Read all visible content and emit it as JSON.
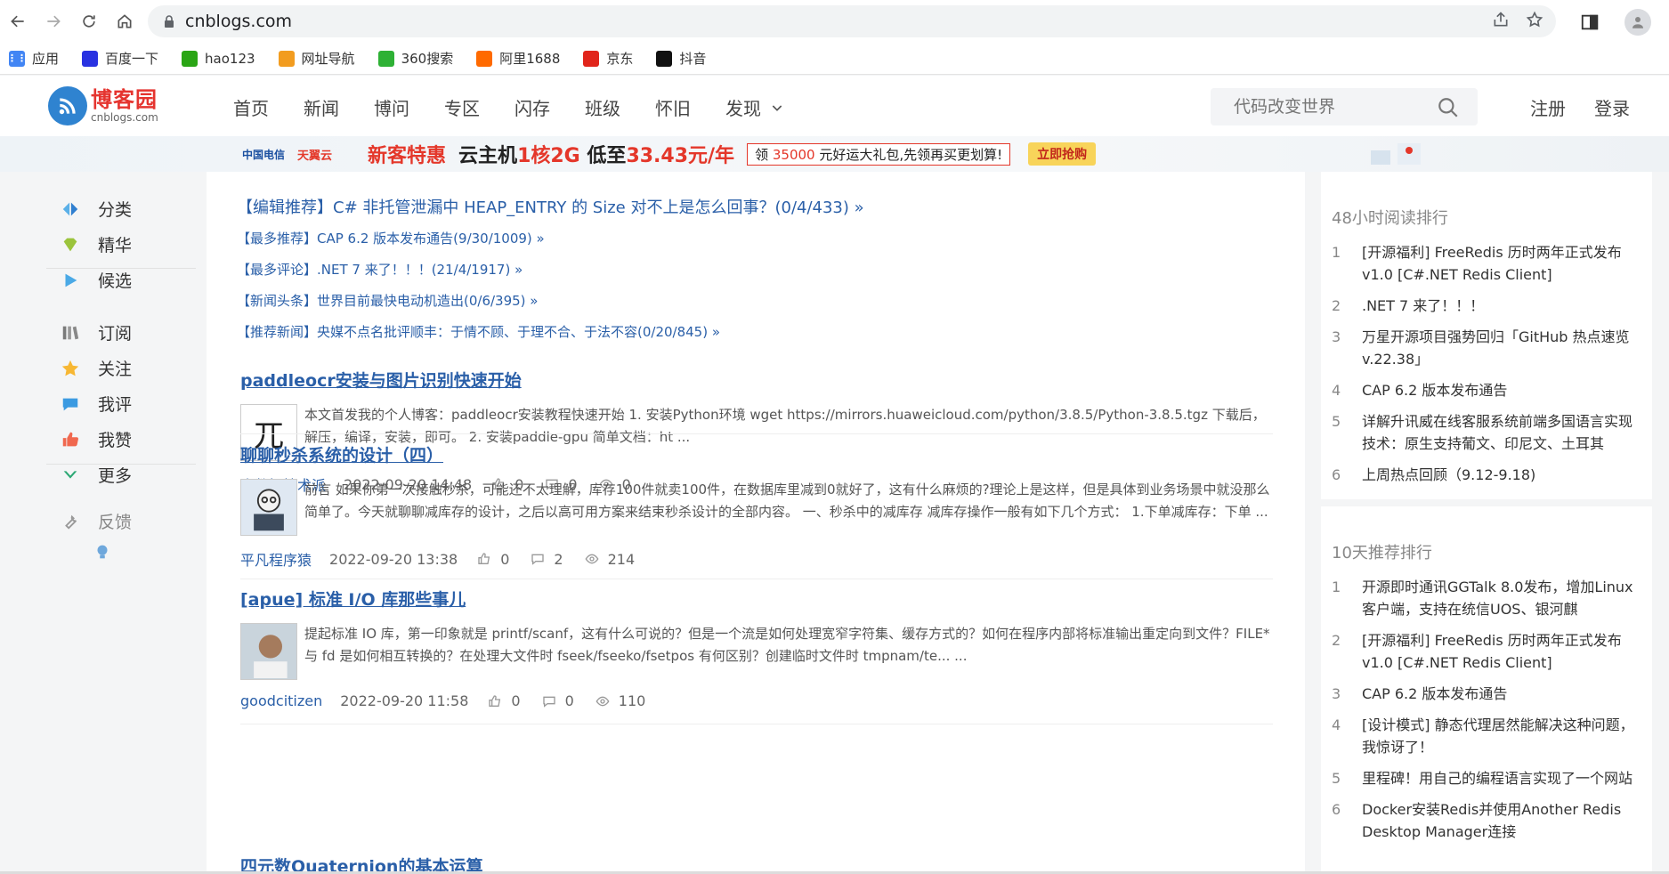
{
  "browser": {
    "url": "cnblogs.com",
    "bookmarks": [
      {
        "label": "应用",
        "icon": "apps-grid-icon",
        "color": "#4285f4"
      },
      {
        "label": "百度一下",
        "icon": "baidu-icon",
        "color": "#2932e1"
      },
      {
        "label": "hao123",
        "icon": "hao123-icon",
        "color": "#2aa515"
      },
      {
        "label": "网址导航",
        "icon": "nav-site-icon",
        "color": "#f29c1f"
      },
      {
        "label": "360搜索",
        "icon": "search-360-icon",
        "color": "#2eb135"
      },
      {
        "label": "阿里1688",
        "icon": "ali1688-icon",
        "color": "#ff6a00"
      },
      {
        "label": "京东",
        "icon": "jd-icon",
        "color": "#e1251b"
      },
      {
        "label": "抖音",
        "icon": "douyin-icon",
        "color": "#111111"
      }
    ]
  },
  "site": {
    "logo_cn": "博客园",
    "logo_en": "cnblogs.com",
    "nav": [
      "首页",
      "新闻",
      "博问",
      "专区",
      "闪存",
      "班级",
      "怀旧",
      "发现"
    ],
    "search_placeholder": "代码改变世界",
    "register": "注册",
    "login": "登录"
  },
  "banner": {
    "brand1": "中国电信",
    "brand2": "天翼云",
    "promo": "新客特惠",
    "offer_prefix": "云主机",
    "offer_spec": "1核2G",
    "offer_mid": "低至",
    "offer_price": "33.43元/年",
    "box_prefix": "领",
    "box_amount": "35000",
    "box_suffix": "元好运大礼包,先领再买更划算!",
    "button": "立即抢购"
  },
  "sidebar": {
    "items": [
      {
        "label": "分类",
        "icon": "category-icon"
      },
      {
        "label": "精华",
        "icon": "gem-icon"
      },
      {
        "label": "候选",
        "icon": "play-icon"
      },
      {
        "label": "订阅",
        "icon": "books-icon"
      },
      {
        "label": "关注",
        "icon": "star-icon"
      },
      {
        "label": "我评",
        "icon": "comment-icon"
      },
      {
        "label": "我赞",
        "icon": "thumbs-up-icon"
      },
      {
        "label": "更多",
        "icon": "chevron-down-icon"
      },
      {
        "label": "反馈",
        "icon": "wrench-icon"
      }
    ]
  },
  "headlines": [
    "【编辑推荐】C# 非托管泄漏中 HEAP_ENTRY 的 Size 对不上是怎么回事？(0/4/433) »",
    "【最多推荐】CAP 6.2 版本发布通告(9/30/1009) »",
    "【最多评论】.NET 7 来了！！！(21/4/1917) »",
    "【新闻头条】世界目前最快电动机造出(0/6/395) »",
    "【推荐新闻】央媒不点名批评顺丰：于情不顾、于理不合、于法不容(0/20/845) »"
  ],
  "posts": [
    {
      "title": "paddleocr安装与图片识别快速开始",
      "summary": "本文首发我的个人博客：paddleocr安装教程快速开始 1. 安装Python环境 wget https://mirrors.huaweicloud.com/python/3.8.5/Python-3.8.5.tgz 下载后，解压，编译，安装，即可。 2. 安装paddle-gpu 简单文档：ht ...",
      "author": "大数据技术派",
      "date": "2022-09-20 14:48",
      "likes": "0",
      "comments": "0",
      "views": "0"
    },
    {
      "title": "聊聊秒杀系统的设计（四）",
      "summary": "前言 如果你第一次接触秒杀，可能还不太理解，库存100件就卖100件，在数据库里减到0就好了，这有什么麻烦的?理论上是这样，但是具体到业务场景中就没那么简单了。今天就聊聊减库存的设计，之后以高可用方案来结束秒杀设计的全部内容。 一、秒杀中的减库存 减库存操作一般有如下几个方式： 1.下单减库存：下单 ...",
      "author": "平凡程序猿",
      "date": "2022-09-20 13:38",
      "likes": "0",
      "comments": "2",
      "views": "214"
    },
    {
      "title": "[apue] 标准 I/O 库那些事儿",
      "summary": "提起标准 IO 库，第一印象就是 printf/scanf，这有什么可说的？但是一个流是如何处理宽窄字符集、缓存方式的？如何在程序内部将标准输出重定向到文件？FILE* 与 fd 是如何相互转换的？在处理大文件时 fseek/fseeko/fsetpos 有何区别？创建临时文件时 tmpnam/te... ...",
      "author": "goodcitizen",
      "date": "2022-09-20 11:58",
      "likes": "0",
      "comments": "0",
      "views": "110"
    },
    {
      "title": "四元数Quaternion的基本运算"
    }
  ],
  "right": {
    "panel1_title": "48小时阅读排行",
    "panel1": [
      {
        "n": "1",
        "t": "[开源福利] FreeRedis 历时两年正式发布 v1.0 [C#.NET Redis Client]"
      },
      {
        "n": "2",
        "t": ".NET 7 来了！！！"
      },
      {
        "n": "3",
        "t": "万星开源项目强势回归「GitHub 热点速览 v.22.38」"
      },
      {
        "n": "4",
        "t": "CAP 6.2 版本发布通告"
      },
      {
        "n": "5",
        "t": "详解升讯威在线客服系统前端多国语言实现技术：原生支持葡文、印尼文、土耳其"
      },
      {
        "n": "6",
        "t": "上周热点回顾（9.12-9.18)"
      }
    ],
    "panel2_title": "10天推荐排行",
    "panel2": [
      {
        "n": "1",
        "t": "开源即时通讯GGTalk 8.0发布，增加Linux客户端，支持在统信UOS、银河麒"
      },
      {
        "n": "2",
        "t": "[开源福利] FreeRedis 历时两年正式发布 v1.0 [C#.NET Redis Client]"
      },
      {
        "n": "3",
        "t": "CAP 6.2 版本发布通告"
      },
      {
        "n": "4",
        "t": "[设计模式] 静态代理居然能解决这种问题，我惊讶了！"
      },
      {
        "n": "5",
        "t": "里程碑！用自己的编程语言实现了一个网站"
      },
      {
        "n": "6",
        "t": "Docker安装Redis并使用Another Redis Desktop Manager连接"
      }
    ]
  }
}
